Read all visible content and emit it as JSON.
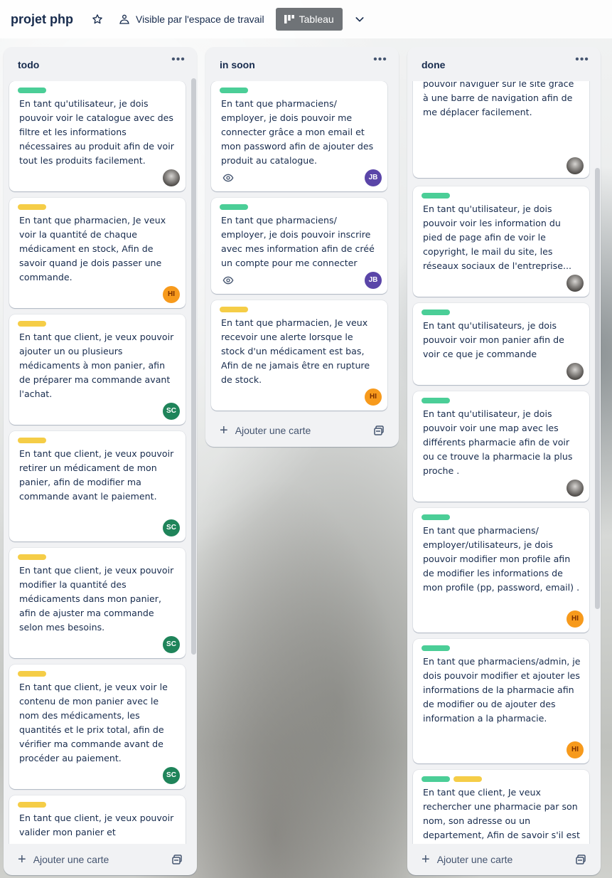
{
  "board": {
    "title": "projet php",
    "visibility_label": "Visible par l'espace de travail",
    "view_label": "Tableau"
  },
  "lists": [
    {
      "title": "todo",
      "add_label": "Ajouter une carte",
      "cards": [
        {
          "labels": [
            "green"
          ],
          "text": "En tant qu'utilisateur, je dois pouvoir voir le catalogue avec des filtre et les informations nécessaires au produit afin de voir tout les produits facilement.",
          "member": "photo"
        },
        {
          "labels": [
            "yellow"
          ],
          "text": "En tant que pharmacien, Je veux voir la quantité de chaque médicament en stock, Afin de savoir quand je dois passer une commande.",
          "member": "HI"
        },
        {
          "labels": [
            "yellow"
          ],
          "text": "En tant que client, je veux pouvoir ajouter un ou plusieurs médicaments à mon panier, afin de préparer ma commande avant l'achat.",
          "member": "SC"
        },
        {
          "labels": [
            "yellow"
          ],
          "text": "En tant que client, je veux pouvoir retirer un médicament de mon panier, afin de modifier ma commande avant le paiement.",
          "member": "SC"
        },
        {
          "labels": [
            "yellow"
          ],
          "text": "En tant que client, je veux pouvoir modifier la quantité des médicaments dans mon panier, afin de ajuster ma commande selon mes besoins.",
          "member": "SC"
        },
        {
          "labels": [
            "yellow"
          ],
          "text": "En tant que client, je veux voir le contenu de mon panier avec le nom des médicaments, les quantités et le prix total, afin de vérifier ma commande avant de procéder au paiement.",
          "member": "SC"
        },
        {
          "labels": [
            "yellow"
          ],
          "text": "En tant que client, je veux pouvoir valider mon panier et",
          "member": ""
        }
      ]
    },
    {
      "title": "in soon",
      "add_label": "Ajouter une carte",
      "cards": [
        {
          "labels": [
            "green"
          ],
          "text": "En tant que pharmaciens/ employer, je dois pouvoir me connecter grâce a mon email et mon password afin de ajouter des produit au catalogue.",
          "member": "JB",
          "watch": true
        },
        {
          "labels": [
            "green"
          ],
          "text": "En tant que pharmaciens/ employer, je dois pouvoir inscrire avec mes information afin de créé un compte pour me connecter",
          "member": "JB",
          "watch": true
        },
        {
          "labels": [
            "yellow"
          ],
          "text": "En tant que pharmacien, Je veux recevoir une alerte lorsque le stock d'un médicament est bas, Afin de ne jamais être en rupture de stock.",
          "member": "HI"
        }
      ]
    },
    {
      "title": "done",
      "add_label": "Ajouter une carte",
      "cards": [
        {
          "labels": [],
          "text": "pouvoir naviguer sur le site grâce à une barre de navigation afin de me déplacer facilement.",
          "member": "photo"
        },
        {
          "labels": [
            "green"
          ],
          "text": "En tant qu'utilisateur, je dois pouvoir voir les information du pied de page afin de voir le copyright, le mail du site, les réseaux sociaux de l'entreprise...",
          "member": "photo"
        },
        {
          "labels": [
            "green"
          ],
          "text": "En tant qu'utilisateurs, je dois pouvoir voir mon panier afin de voir ce que je commande",
          "member": "photo"
        },
        {
          "labels": [
            "green"
          ],
          "text": "En tant qu'utilisateur, je dois pouvoir voir une map avec les différents pharmacie afin de voir ou ce trouve la pharmacie la plus proche .",
          "member": "photo"
        },
        {
          "labels": [
            "green"
          ],
          "text": "En tant que pharmaciens/ employer/utilisateurs, je dois pouvoir modifier mon profile afin de modifier les informations de mon profile (pp, password, email) .",
          "member": "HI"
        },
        {
          "labels": [
            "green"
          ],
          "text": "En tant que pharmaciens/admin, je dois pouvoir modifier et ajouter les informations de la pharmacie afin de modifier ou de ajouter des information a la pharmacie.",
          "member": "HI"
        },
        {
          "labels": [
            "green",
            "yellow"
          ],
          "text": "En tant que client, Je veux rechercher une pharmacie par son nom, son adresse ou un departement, Afin de savoir s'il est disponible en pharmacie.",
          "member": "photo"
        }
      ]
    }
  ]
}
